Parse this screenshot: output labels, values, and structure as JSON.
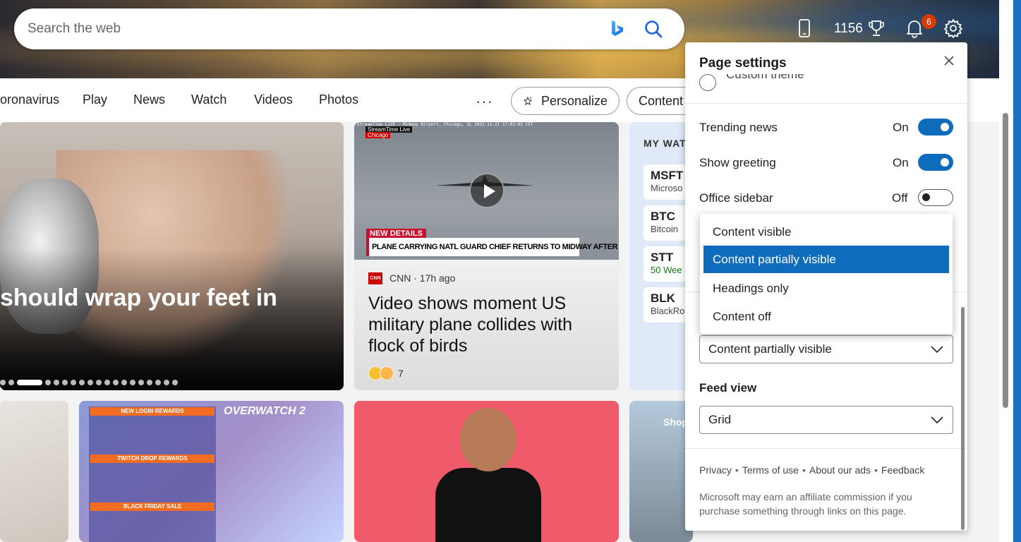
{
  "search": {
    "placeholder": "Search the web"
  },
  "header": {
    "points": "1156",
    "notifications_count": "6"
  },
  "nav": {
    "items": [
      "oronavirus",
      "Play",
      "News",
      "Watch",
      "Videos",
      "Photos"
    ],
    "more": "···",
    "personalize": "Personalize",
    "content": "Content"
  },
  "hero": {
    "headline": "should wrap your feet in"
  },
  "news_card": {
    "stream_header": "StreamTime LIVE - Midway Airport, Chicago, IL 2022-11-21 17:01:02 CST",
    "stream_tag": "StreamTime Live",
    "stream_location": "Chicago",
    "overlay_tag": "NEW DETAILS",
    "overlay_text": "PLANE CARRYING NATL GUARD CHIEF RETURNS TO MIDWAY AFTER BIRD STRIKE",
    "source_logo": "CNN",
    "source": "CNN · 17h ago",
    "title": "Video shows moment US military plane collides with flock of birds",
    "reaction_count": "7"
  },
  "watchlist": {
    "title": "MY WAT",
    "stocks": [
      {
        "symbol": "MSFT",
        "name": "Microso"
      },
      {
        "symbol": "BTC",
        "name": "Bitcoin"
      },
      {
        "symbol": "STT",
        "name": "50 Wee"
      },
      {
        "symbol": "BLK",
        "name": "BlackRo"
      }
    ]
  },
  "tiles": {
    "overwatch_logo": "OVERWATCH 2",
    "rewards_1": "NEW LOGIN REWARDS",
    "rewards_2": "TWITCH DROP REWARDS",
    "rewards_3": "BLACK FRIDAY SALE",
    "shop_label": "Shop"
  },
  "settings": {
    "title": "Page settings",
    "partial_radio_label": "Custom theme",
    "rows": [
      {
        "label": "Trending news",
        "state": "On",
        "on": true
      },
      {
        "label": "Show greeting",
        "state": "On",
        "on": true
      },
      {
        "label": "Office sidebar",
        "state": "Off",
        "on": false
      }
    ],
    "dropdown_options": [
      "Content visible",
      "Content partially visible",
      "Headings only",
      "Content off"
    ],
    "selected_option": "Content partially visible",
    "content_select_value": "Content partially visible",
    "feed_view_label": "Feed view",
    "feed_view_value": "Grid",
    "footer_links": [
      "Privacy",
      "Terms of use",
      "About our ads",
      "Feedback"
    ],
    "disclaimer": "Microsoft may earn an affiliate commission if you purchase something through links on this page."
  },
  "colors": {
    "accent": "#0f6cbd",
    "badge": "#d83b01",
    "cnn": "#cc0000"
  }
}
